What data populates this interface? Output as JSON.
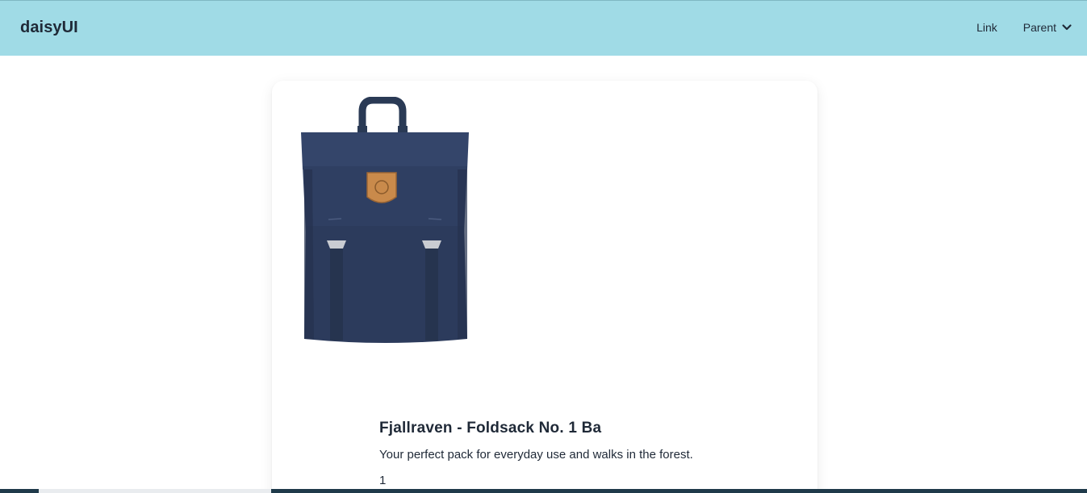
{
  "navbar": {
    "brand": "daisyUI",
    "link_label": "Link",
    "parent_label": "Parent",
    "background": "#a0dbe6"
  },
  "card": {
    "image_icon": "backpack-image",
    "title": "Fjallraven - Foldsack No. 1 Ba",
    "description": "Your perfect pack for everyday use and walks in the forest.",
    "quantity": "1"
  }
}
